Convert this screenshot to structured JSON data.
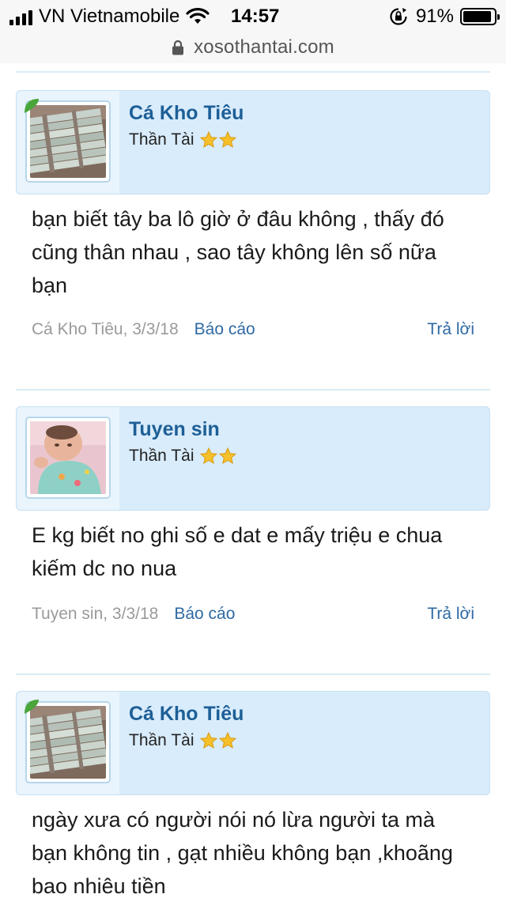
{
  "status_bar": {
    "carrier": "VN Vietnamobile",
    "time": "14:57",
    "battery": "91%",
    "battery_level": 0.91
  },
  "browser": {
    "url": "xosothantai.com"
  },
  "comments": [
    {
      "user_name": "Cá Kho Tiêu",
      "user_title": "Thần Tài",
      "stars": 2,
      "avatar": "money-stack",
      "text": "bạn biết tây ba lô giờ ở đâu không , thấy đó cũng thân nhau , sao tây không lên số nữa bạn",
      "meta_author": "Cá Kho Tiêu, 3/3/18",
      "report_label": "Báo cáo",
      "reply_label": "Trả lời"
    },
    {
      "user_name": "Tuyen sin",
      "user_title": "Thần Tài",
      "stars": 2,
      "avatar": "baby-photo",
      "text": "E kg biết no ghi số e dat e mấy triệu e chua kiếm dc no nua",
      "meta_author": "Tuyen sin, 3/3/18",
      "report_label": "Báo cáo",
      "reply_label": "Trả lời"
    },
    {
      "user_name": "Cá Kho Tiêu",
      "user_title": "Thần Tài",
      "stars": 2,
      "avatar": "money-stack",
      "text": "ngày xưa có người nói nó lừa người ta mà bạn không tin , gạt nhiều không bạn ,khoãng bao nhiêu tiền",
      "meta_author": "",
      "report_label": "",
      "reply_label": ""
    }
  ]
}
